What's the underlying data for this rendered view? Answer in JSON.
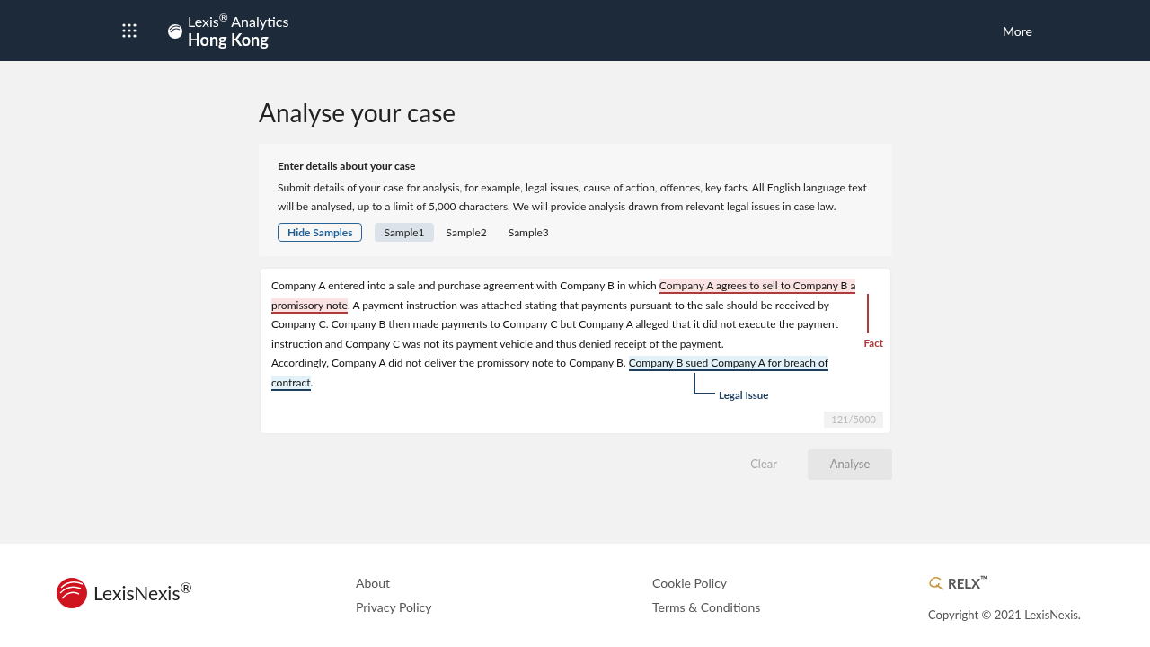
{
  "header": {
    "brand_top": "Lexis$^{®}$ Analytics",
    "brand_bottom": "Hong Kong",
    "more": "More"
  },
  "page_title": "Analyse your case",
  "intro": {
    "heading": "Enter details about your case",
    "text": "Submit details of your case for analysis, for example, legal issues, cause of action, offences, key facts. All English language text will be analysed, up to a limit of 5,000 characters. We will provide analysis drawn from relevant legal issues in case law."
  },
  "hide_samples": "Hide Samples",
  "samples": [
    {
      "label": "Sample1",
      "selected": true
    },
    {
      "label": "Sample2",
      "selected": false
    },
    {
      "label": "Sample3",
      "selected": false
    }
  ],
  "case_text": [
    [
      {
        "kind": "plain",
        "text": "Company A entered into a sale and purchase agreement with Company B in which "
      },
      {
        "kind": "fact",
        "text": "Company A agrees to sell to Company B a promissory note"
      },
      {
        "kind": "plain",
        "text": ". A payment instruction was attached stating that payments pursuant to the sale should be received by Company C. Company B then made payments to Company C but Company A alleged that it did not execute the payment instruction and Company C was not its payment vehicle and thus denied receipt of the payment."
      }
    ],
    [
      {
        "kind": "plain",
        "text": "Accordingly, Company A did not deliver the promissory note to Company B. "
      },
      {
        "kind": "issue",
        "text": "Company B sued Company A for breach of contract"
      },
      {
        "kind": "plain",
        "text": "."
      }
    ]
  ],
  "annotations": [
    {
      "kind": "fact",
      "label": "Fact"
    },
    {
      "kind": "issue",
      "label": "Legal Issue"
    }
  ],
  "counter": "121/5000",
  "actions": [
    {
      "kind": "clear",
      "label": "Clear",
      "disabled": true
    },
    {
      "kind": "analyse",
      "label": "Analyse",
      "disabled": true
    }
  ],
  "footer": {
    "logo": "LexisNexis$^{®}$",
    "links_1": [
      "About",
      "Privacy Policy"
    ],
    "links_2": [
      "Cookie Policy",
      "Terms & Conditions"
    ],
    "relx": "RELX$^{™}$",
    "copyright": "Copyright © 2021 LexisNexis."
  }
}
